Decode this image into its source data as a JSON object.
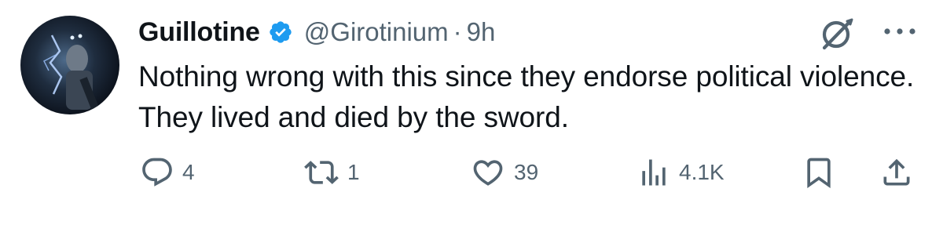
{
  "tweet": {
    "author_name": "Guillotine",
    "handle": "@Girotinium",
    "separator": "·",
    "time": "9h",
    "text": "Nothing wrong with this since they endorse political violence. They lived and died by the sword.",
    "verified": true
  },
  "actions": {
    "replies": "4",
    "reposts": "1",
    "likes": "39",
    "views": "4.1K"
  },
  "icons": {
    "avatar": "avatar",
    "verified": "verified-badge-icon",
    "grok": "grok-icon",
    "more": "more-icon",
    "reply": "reply-icon",
    "repost": "repost-icon",
    "like": "heart-icon",
    "views": "views-icon",
    "bookmark": "bookmark-icon",
    "share": "share-icon"
  },
  "colors": {
    "text": "#0f1419",
    "secondary": "#536471",
    "verified": "#1d9bf0"
  }
}
